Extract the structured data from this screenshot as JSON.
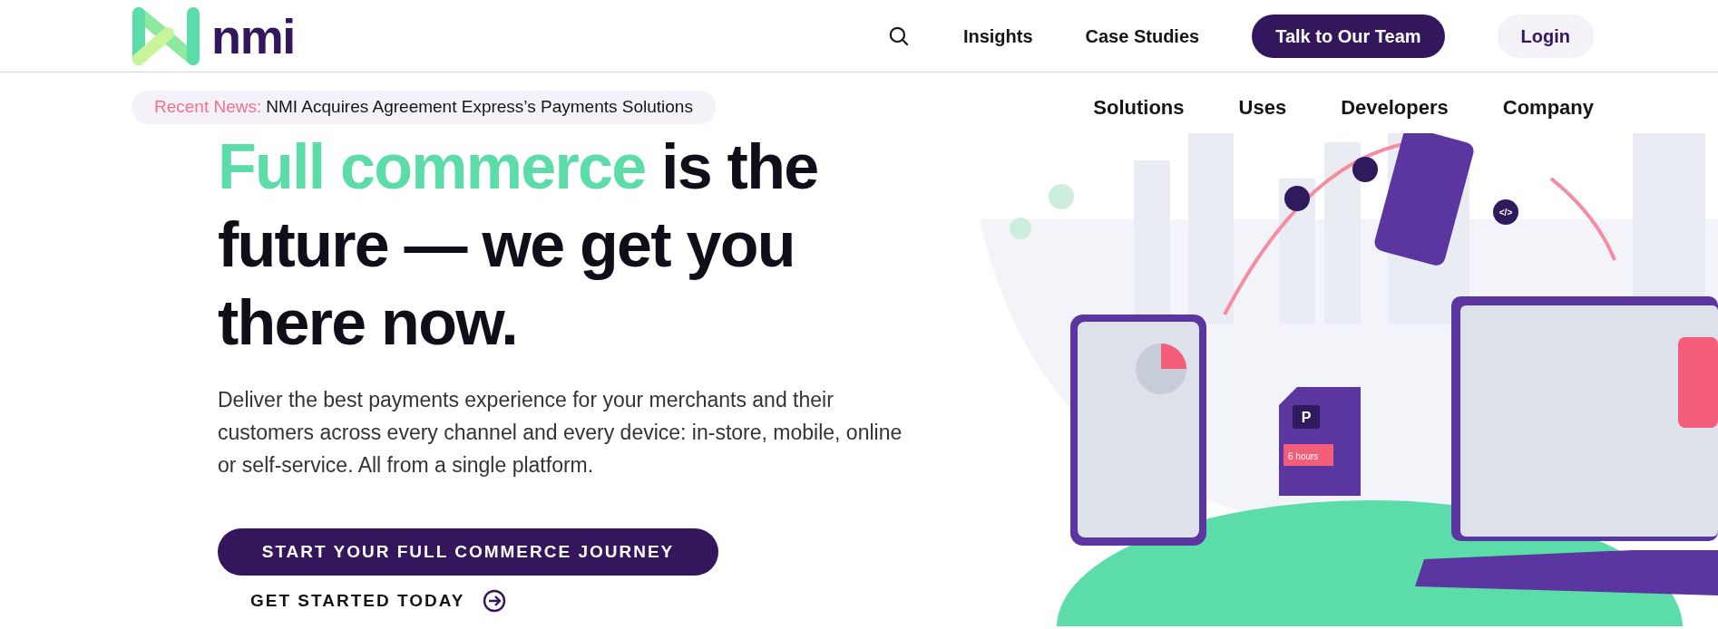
{
  "header": {
    "logo": "nmi",
    "links": [
      {
        "label": "Insights"
      },
      {
        "label": "Case Studies"
      }
    ],
    "cta": "Talk to Our Team",
    "login": "Login"
  },
  "news": {
    "prefix": "Recent News:",
    "text": "NMI Acquires Agreement Express’s Payments Solutions"
  },
  "nav": [
    {
      "label": "Solutions"
    },
    {
      "label": "Uses"
    },
    {
      "label": "Developers"
    },
    {
      "label": "Company"
    }
  ],
  "hero": {
    "highlight": "Full commerce",
    "rest_line1": " is the",
    "line2": "future — we get you",
    "line3": "there now.",
    "body": "Deliver the best payments experience for your merchants and their customers across every channel and every device: in-store, mobile, online or self-service. All from a single platform.",
    "primary": "START YOUR FULL COMMERCE JOURNEY",
    "secondary": "GET STARTED TODAY"
  },
  "illustration": {
    "kiosk_sign": "P",
    "kiosk_label": "6 hours",
    "code_tag": "</>"
  }
}
